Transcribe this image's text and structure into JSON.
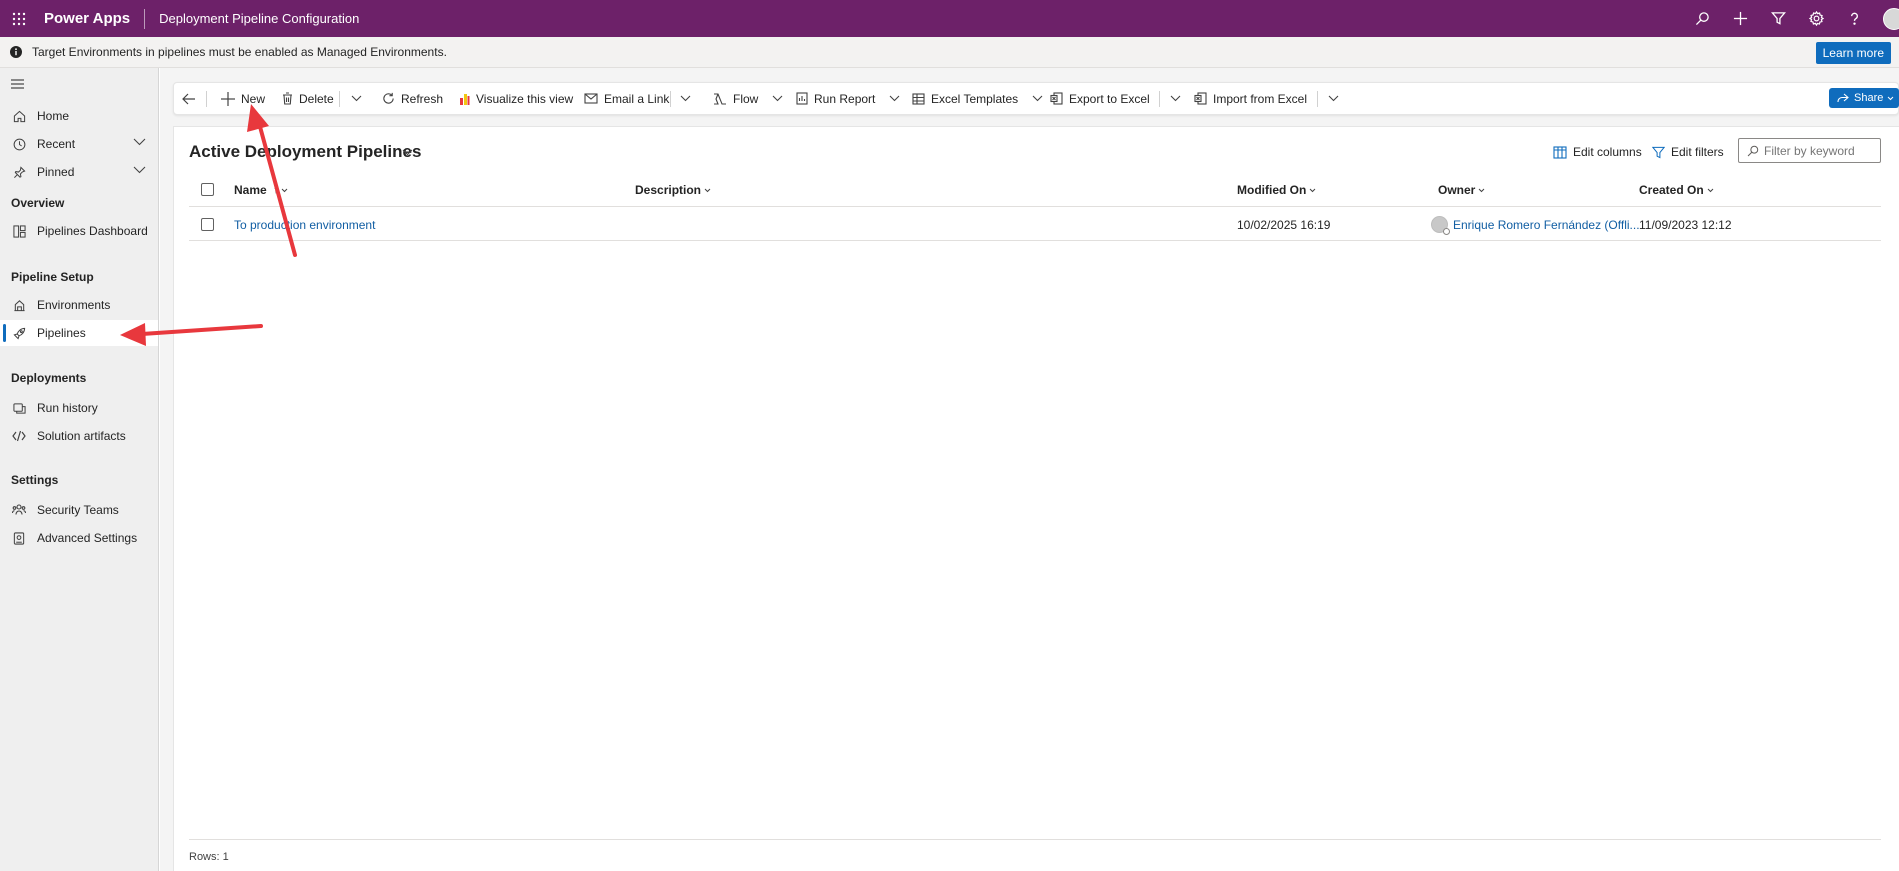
{
  "topbar": {
    "brand": "Power Apps",
    "app_title": "Deployment Pipeline Configuration",
    "icons": [
      "search-icon",
      "plus-icon",
      "filter-icon",
      "gear-icon",
      "help-icon"
    ]
  },
  "banner": {
    "message": "Target Environments in pipelines must be enabled as Managed Environments.",
    "button": "Learn more"
  },
  "sidebar": {
    "items": [
      {
        "label": "Home",
        "icon": "home-icon"
      },
      {
        "label": "Recent",
        "icon": "clock-icon"
      },
      {
        "label": "Pinned",
        "icon": "pin-icon"
      }
    ],
    "sections": [
      {
        "title": "Overview",
        "items": [
          {
            "label": "Pipelines Dashboard",
            "icon": "dashboard-icon"
          }
        ]
      },
      {
        "title": "Pipeline Setup",
        "items": [
          {
            "label": "Environments",
            "icon": "environment-icon"
          },
          {
            "label": "Pipelines",
            "icon": "rocket-icon",
            "active": true
          }
        ]
      },
      {
        "title": "Deployments",
        "items": [
          {
            "label": "Run history",
            "icon": "history-icon"
          },
          {
            "label": "Solution artifacts",
            "icon": "code-icon"
          }
        ]
      },
      {
        "title": "Settings",
        "items": [
          {
            "label": "Security Teams",
            "icon": "team-icon"
          },
          {
            "label": "Advanced Settings",
            "icon": "settings-icon"
          }
        ]
      }
    ]
  },
  "commandbar": {
    "new": "New",
    "delete": "Delete",
    "refresh": "Refresh",
    "visualize": "Visualize this view",
    "email_link": "Email a Link",
    "flow": "Flow",
    "run_report": "Run Report",
    "excel_templates": "Excel Templates",
    "export_excel": "Export to Excel",
    "import_excel": "Import from Excel",
    "share": "Share"
  },
  "view": {
    "title": "Active Deployment Pipelines",
    "edit_columns": "Edit columns",
    "edit_filters": "Edit filters",
    "filter_placeholder": "Filter by keyword"
  },
  "grid": {
    "columns": [
      "Name",
      "Description",
      "Modified On",
      "Owner",
      "Created On"
    ],
    "rows": [
      {
        "name": "To production environment",
        "description": "",
        "modified_on": "10/02/2025 16:19",
        "owner": "Enrique Romero Fernández (Offli...",
        "created_on": "11/09/2023 12:12"
      }
    ],
    "footer": "Rows: 1"
  },
  "colors": {
    "topbar": "#6d2169",
    "accent": "#0f6cbd",
    "annotation": "#e8383d"
  }
}
